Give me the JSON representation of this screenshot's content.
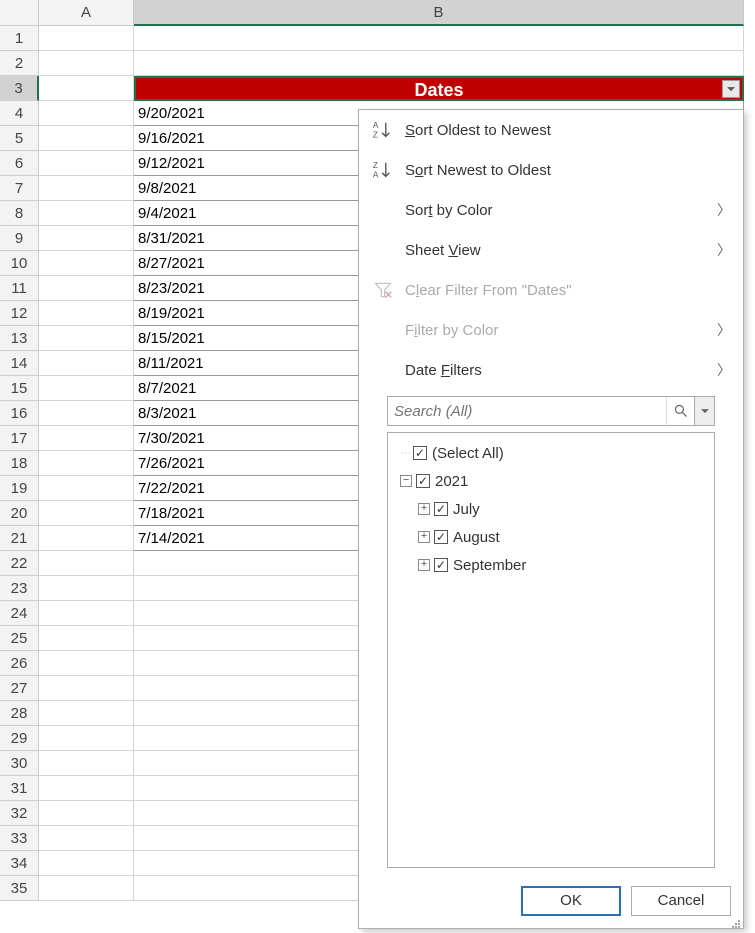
{
  "columns": {
    "A": "A",
    "B": "B"
  },
  "header": {
    "label": "Dates",
    "cell": "B3"
  },
  "dates": [
    "9/20/2021",
    "9/16/2021",
    "9/12/2021",
    "9/8/2021",
    "9/4/2021",
    "8/31/2021",
    "8/27/2021",
    "8/23/2021",
    "8/19/2021",
    "8/15/2021",
    "8/11/2021",
    "8/7/2021",
    "8/3/2021",
    "7/30/2021",
    "7/26/2021",
    "7/22/2021",
    "7/18/2021",
    "7/14/2021"
  ],
  "row_numbers": [
    1,
    2,
    3,
    4,
    5,
    6,
    7,
    8,
    9,
    10,
    11,
    12,
    13,
    14,
    15,
    16,
    17,
    18,
    19,
    20,
    21,
    22,
    23,
    24,
    25,
    26,
    27,
    28,
    29,
    30,
    31,
    32,
    33,
    34,
    35
  ],
  "dropdown": {
    "sort_asc": "Sort Oldest to Newest",
    "sort_desc": "Sort Newest to Oldest",
    "sort_asc_u": "S",
    "sort_desc_u": "o",
    "sort_color": "Sort by Color",
    "sort_color_u": "t",
    "sheet_view": "Sheet View",
    "sheet_view_u": "V",
    "clear_filter_pre": "C",
    "clear_filter_u": "l",
    "clear_filter": "ear Filter From \"Dates\"",
    "filter_color_pre": "F",
    "filter_color_u": "i",
    "filter_color_rest": "lter by Color",
    "date_filters_pre": "Date ",
    "date_filters_u": "F",
    "date_filters_rest": "ilters",
    "search_placeholder": "Search (All)",
    "tree": {
      "select_all": "(Select All)",
      "year": "2021",
      "months": [
        "July",
        "August",
        "September"
      ]
    },
    "ok": "OK",
    "cancel": "Cancel"
  }
}
